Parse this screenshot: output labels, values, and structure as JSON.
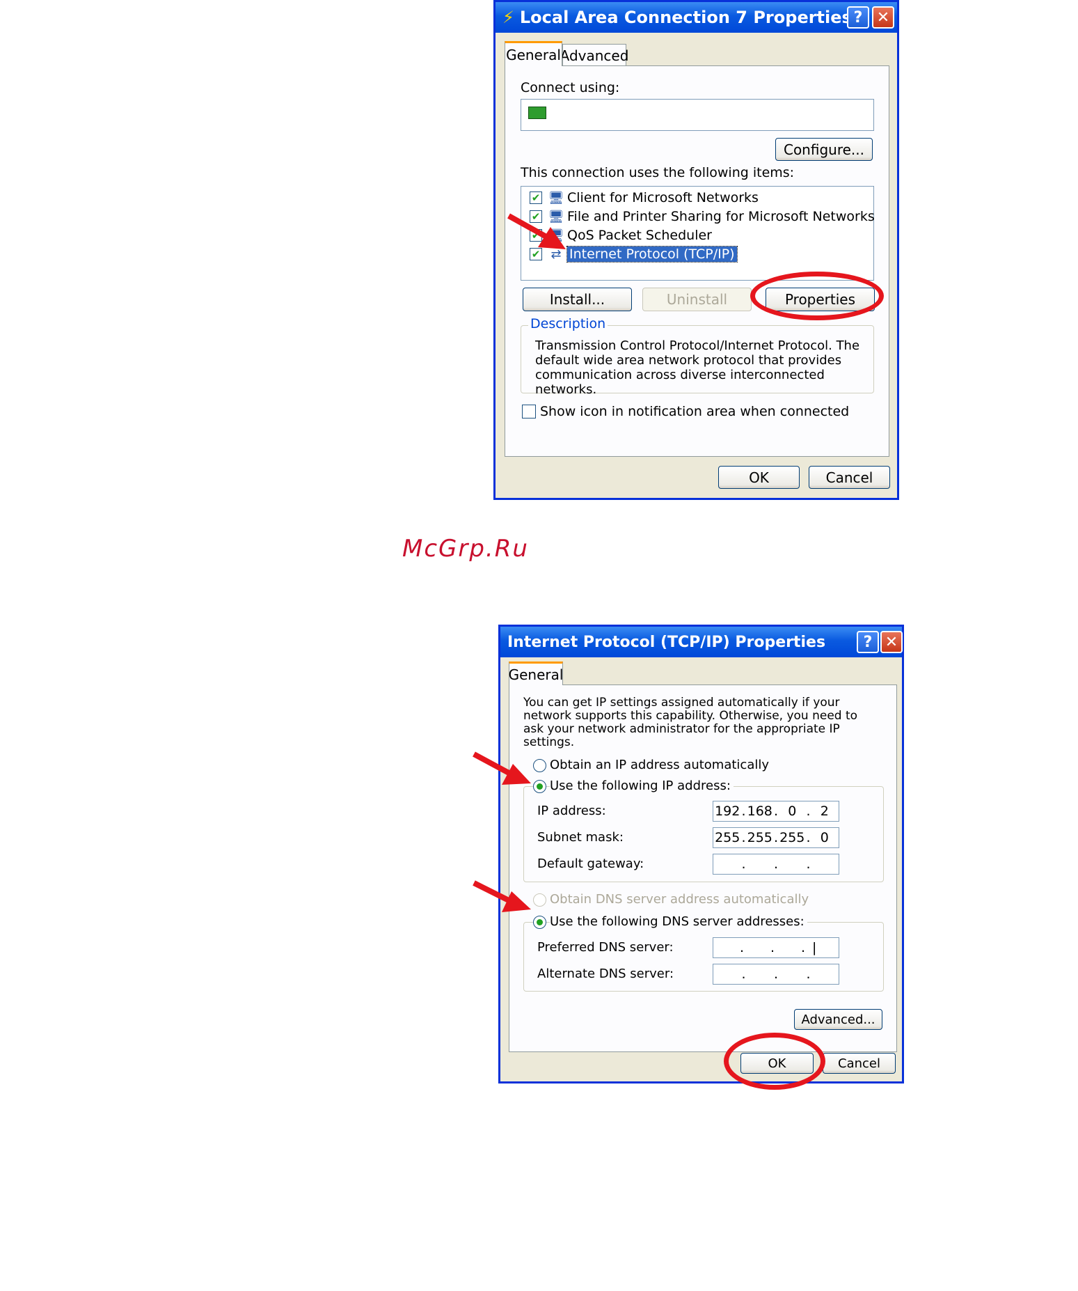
{
  "dialog1": {
    "title": "Local Area Connection 7 Properties",
    "help_label": "?",
    "close_label": "✕",
    "tabs": [
      "General",
      "Advanced"
    ],
    "connect_using_label": "Connect using:",
    "configure_label": "Configure...",
    "items_label": "This connection uses the following items:",
    "items": [
      {
        "label": "Client for Microsoft Networks",
        "checked": true
      },
      {
        "label": "File and Printer Sharing for Microsoft Networks",
        "checked": true
      },
      {
        "label": "QoS Packet Scheduler",
        "checked": true
      },
      {
        "label": "Internet Protocol (TCP/IP)",
        "checked": true,
        "selected": true
      }
    ],
    "install_label": "Install...",
    "uninstall_label": "Uninstall",
    "properties_label": "Properties",
    "description_legend": "Description",
    "description_text": "Transmission Control Protocol/Internet Protocol. The default wide area network protocol that provides communication across diverse interconnected networks.",
    "show_icon_label": "Show icon in notification area when connected",
    "ok_label": "OK",
    "cancel_label": "Cancel"
  },
  "watermark": "McGrp.Ru",
  "dialog2": {
    "title": "Internet Protocol (TCP/IP) Properties",
    "help_label": "?",
    "close_label": "✕",
    "tab": "General",
    "intro_text": "You can get IP settings assigned automatically if your network supports this capability. Otherwise, you need to ask your network administrator for the appropriate IP settings.",
    "obtain_ip_label": "Obtain an IP address automatically",
    "use_ip_label": "Use the following IP address:",
    "ip_label": "IP address:",
    "ip_value": [
      "192",
      "168",
      "0",
      "2"
    ],
    "subnet_label": "Subnet mask:",
    "subnet_value": [
      "255",
      "255",
      "255",
      "0"
    ],
    "gateway_label": "Default gateway:",
    "obtain_dns_label": "Obtain DNS server address automatically",
    "use_dns_label": "Use the following DNS server addresses:",
    "preferred_dns_label": "Preferred DNS server:",
    "alternate_dns_label": "Alternate DNS server:",
    "advanced_label": "Advanced...",
    "ok_label": "OK",
    "cancel_label": "Cancel"
  },
  "colors": {
    "titlebar": "#0a5ae0",
    "annotation": "#e5161d",
    "selection": "#316ac5"
  }
}
